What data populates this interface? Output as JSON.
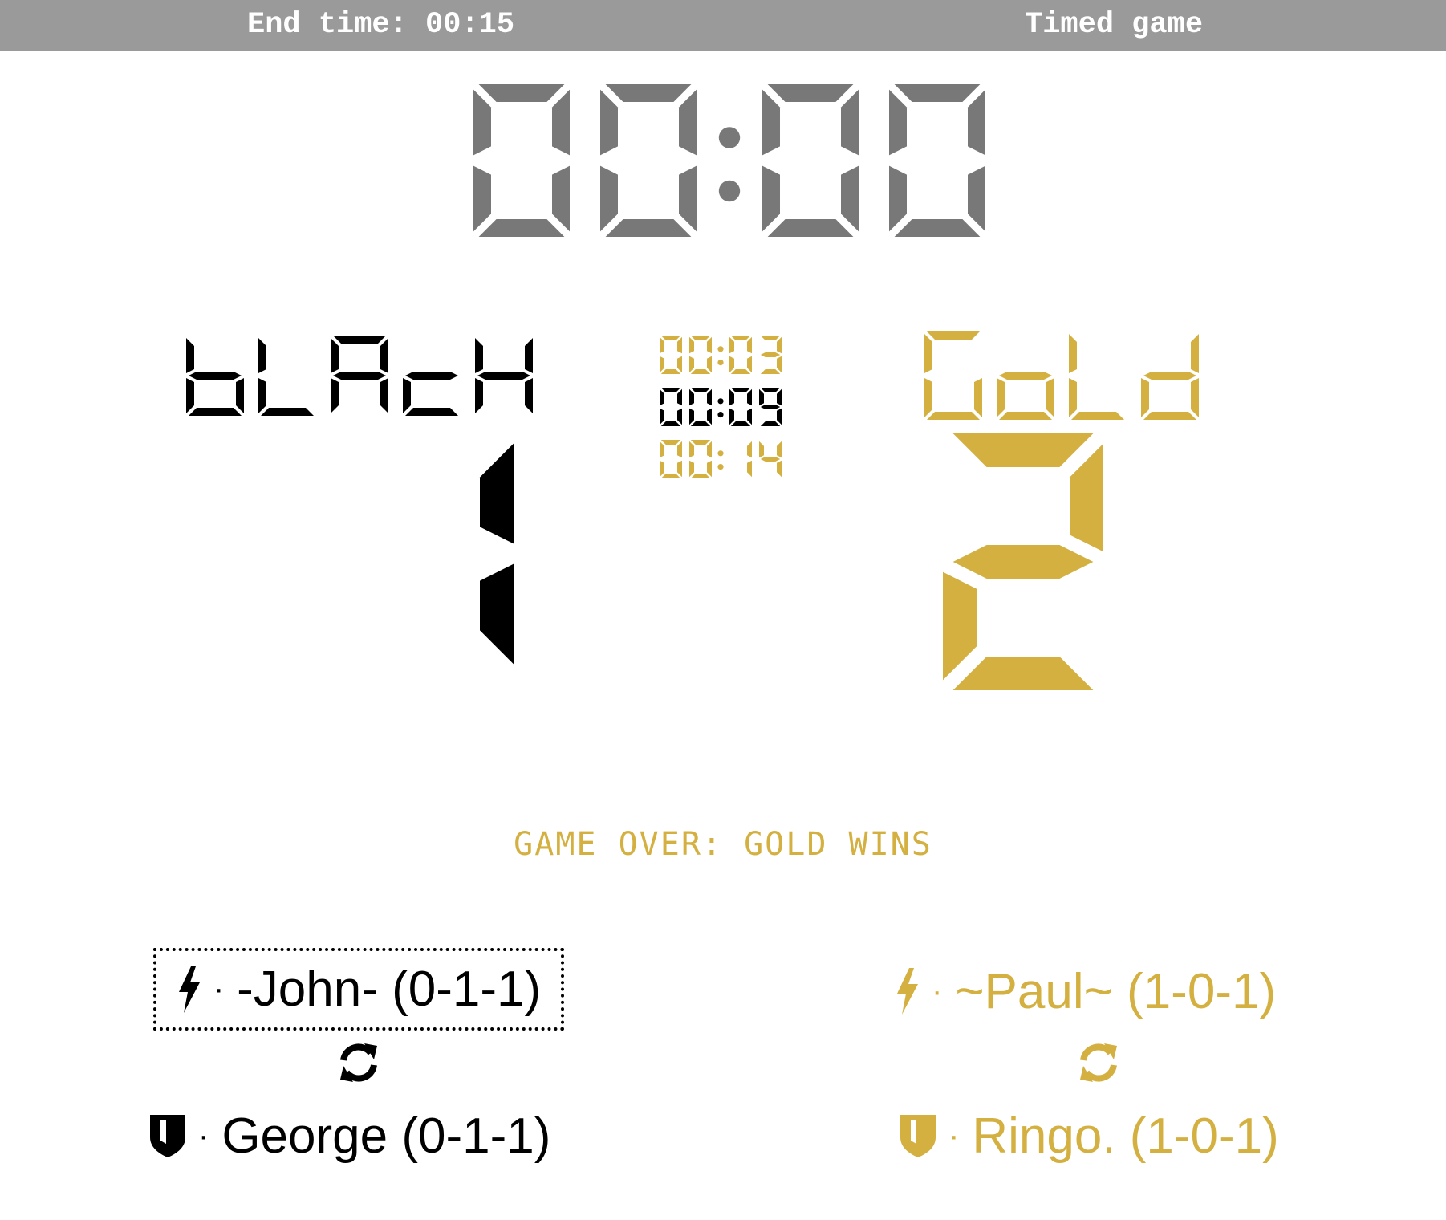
{
  "top_bar": {
    "end_time": "End time: 00:15",
    "mode": "Timed game"
  },
  "colors": {
    "bar": "#9a9a9a",
    "clock": "#787878",
    "black": "#000000",
    "gold": "#d4b041",
    "white": "#ffffff"
  },
  "main_clock": "00:00",
  "black_team": {
    "label": "bLAcK",
    "score": "1",
    "queen": "-John- (0-1-1)",
    "warrior": "George (0-1-1)",
    "queen_icon": "lightning-bolt-icon",
    "warrior_icon": "shield-icon"
  },
  "gold_team": {
    "label": "GoLd",
    "score": "2",
    "queen": "~Paul~ (1-0-1)",
    "warrior": "Ringo. (1-0-1)",
    "queen_icon": "lightning-bolt-icon",
    "warrior_icon": "shield-icon"
  },
  "events": [
    {
      "time": "00:03",
      "team": "gold"
    },
    {
      "time": "00:09",
      "team": "black"
    },
    {
      "time": "00:14",
      "team": "gold"
    }
  ],
  "status": "GAME OVER: GOLD WINS",
  "dot_separator": "·",
  "swap_icon": "swap-arrows-icon"
}
